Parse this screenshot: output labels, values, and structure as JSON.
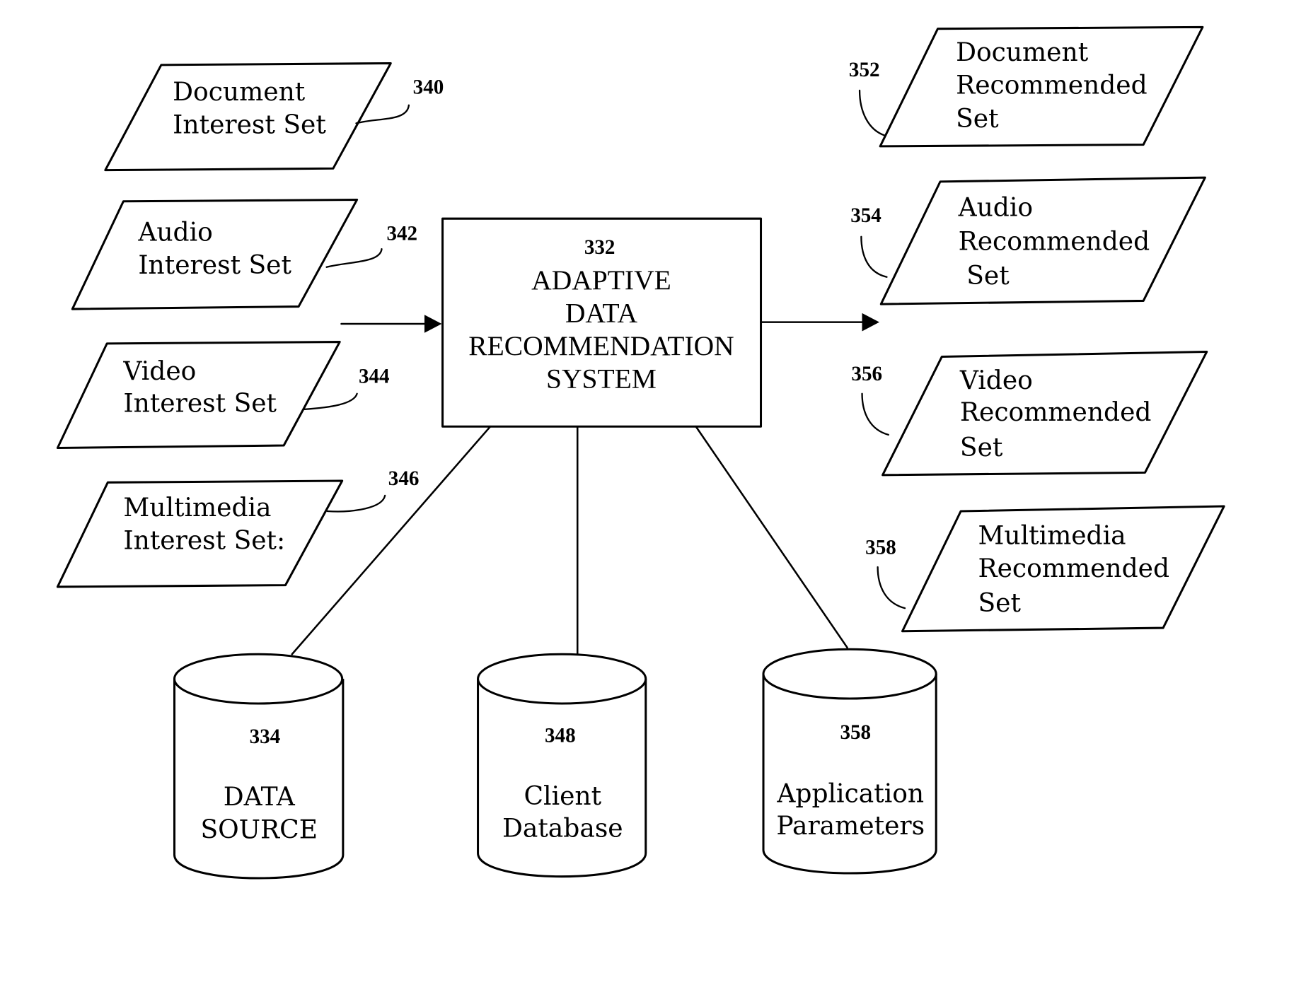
{
  "figure": {
    "central_system": {
      "ref": "332",
      "lines": [
        "ADAPTIVE",
        "DATA",
        "RECOMMENDATION",
        "SYSTEM"
      ]
    },
    "inputs": [
      {
        "ref": "340",
        "lines": [
          "Document",
          "Interest Set"
        ]
      },
      {
        "ref": "342",
        "lines": [
          "Audio",
          "Interest Set"
        ]
      },
      {
        "ref": "344",
        "lines": [
          "Video",
          "Interest Set"
        ]
      },
      {
        "ref": "346",
        "lines": [
          "Multimedia",
          "Interest Set:"
        ]
      }
    ],
    "outputs": [
      {
        "ref": "352",
        "lines": [
          "Document",
          "Recommended",
          "Set"
        ]
      },
      {
        "ref": "354",
        "lines": [
          "Audio",
          "Recommended",
          "Set"
        ]
      },
      {
        "ref": "356",
        "lines": [
          "Video",
          "Recommended",
          "Set"
        ]
      },
      {
        "ref": "358",
        "lines": [
          "Multimedia",
          "Recommended",
          "Set"
        ]
      }
    ],
    "stores": [
      {
        "ref": "334",
        "lines": [
          "DATA",
          "SOURCE"
        ]
      },
      {
        "ref": "348",
        "lines": [
          "Client",
          "Database"
        ]
      },
      {
        "ref": "358",
        "lines": [
          "Application",
          "Parameters"
        ]
      }
    ]
  }
}
